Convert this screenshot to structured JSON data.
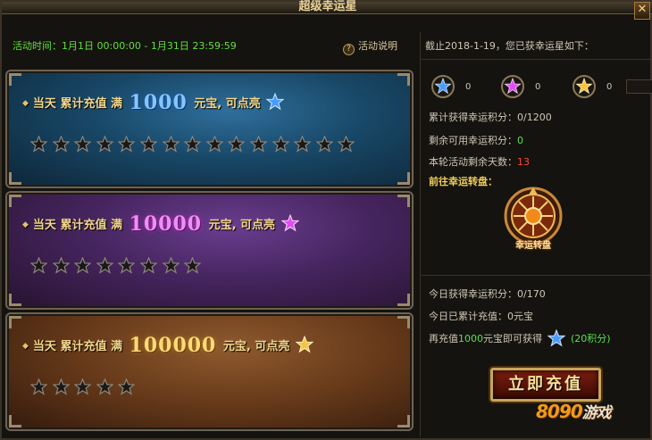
{
  "window": {
    "title": "超级幸运星",
    "close_glyph": "✕"
  },
  "activity": {
    "time_label": "活动时间：",
    "time_range": "1月1日 00:00:00 - 1月31日 23:59:59",
    "help_glyph": "?",
    "help_label": "活动说明"
  },
  "tiers": [
    {
      "prefix": "当天 累计充值 满",
      "amount": "1000",
      "suffix": "元宝, 可点亮",
      "star_color": "blue",
      "slots": 15
    },
    {
      "prefix": "当天 累计充值 满",
      "amount": "10000",
      "suffix": "元宝, 可点亮",
      "star_color": "purple",
      "slots": 8
    },
    {
      "prefix": "当天 累计充值 满",
      "amount": "100000",
      "suffix": "元宝, 可点亮",
      "star_color": "gold",
      "slots": 5
    }
  ],
  "status": {
    "as_of": "截止2018-1-19，您已获幸运星如下：",
    "gems": [
      {
        "color": "blue",
        "count": "0"
      },
      {
        "color": "purple",
        "count": "0"
      },
      {
        "color": "gold",
        "count": "0"
      }
    ],
    "total_points_label": "累计获得幸运积分：",
    "total_points_value": "0/1200",
    "remaining_points_label": "剩余可用幸运积分：",
    "remaining_points_value": "0",
    "days_left_label": "本轮活动剩余天数：",
    "days_left_value": "13",
    "goto_wheel": "前往幸运转盘：",
    "wheel_label": "幸运转盘",
    "today_points_label": "今日获得幸运积分：",
    "today_points_value": "0/170",
    "today_recharge_label": "今日已累计充值：",
    "today_recharge_value": "0元宝",
    "need_prefix": "再充值",
    "need_amount": "1000",
    "need_mid": "元宝即可获得",
    "need_points": "(20积分)"
  },
  "recharge_button": "立即充值",
  "watermark": {
    "brand": "8090",
    "cn": "游戏"
  },
  "colors": {
    "star_blue": "#4a9bff",
    "star_purple": "#e04df0",
    "star_gold": "#f5c542",
    "green": "#58e24a",
    "red": "#ff4a3a"
  }
}
